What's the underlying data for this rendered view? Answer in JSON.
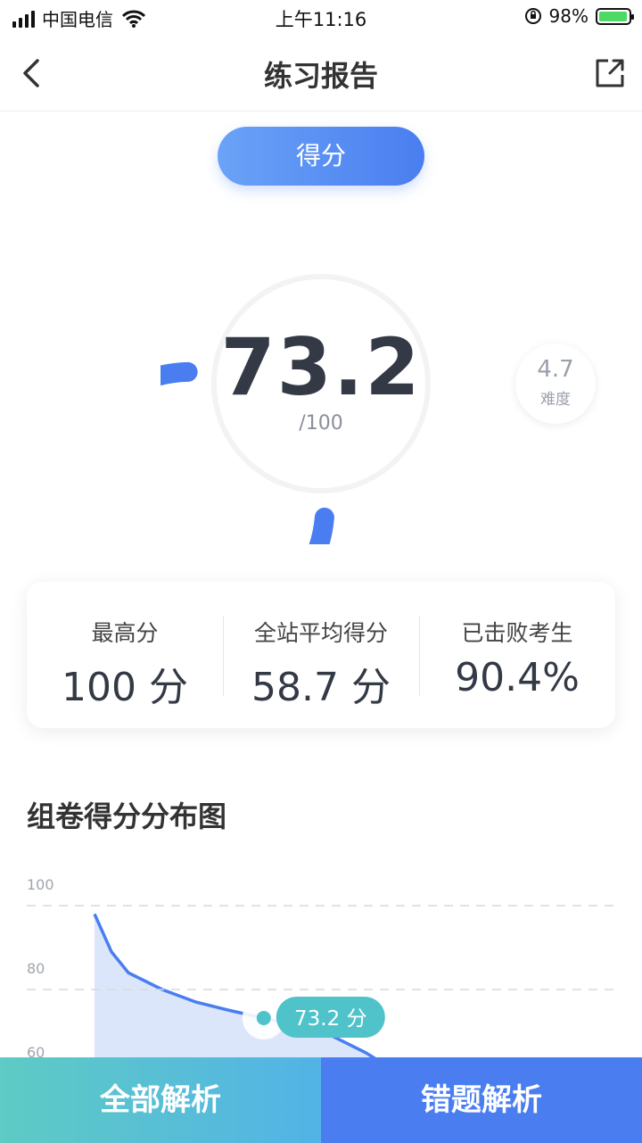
{
  "status_bar": {
    "carrier": "中国电信",
    "time": "上午11:16",
    "battery_percent": "98%",
    "battery_level": 0.98,
    "icons": [
      "signal-icon",
      "wifi-icon",
      "orientation-lock-icon",
      "battery-charging-icon"
    ]
  },
  "nav": {
    "title": "练习报告",
    "back_icon": "chevron-left-icon",
    "share_icon": "share-external-icon"
  },
  "score_tab": {
    "label": "得分"
  },
  "score": {
    "value": "73.2",
    "total": "/100",
    "numeric": 73.2,
    "max": 100,
    "accent_color": "#4a7ef0"
  },
  "difficulty": {
    "value": "4.7",
    "label": "难度"
  },
  "stats": [
    {
      "label": "最高分",
      "value": "100 分"
    },
    {
      "label": "全站平均得分",
      "value": "58.7 分"
    },
    {
      "label": "已击败考生",
      "value": "90.4%"
    }
  ],
  "distribution": {
    "title": "组卷得分分布图",
    "marker_label": "73.2 分",
    "accent_color": "#4a7ef0",
    "fill_color": "#dce6fb",
    "marker_color": "#4fc3c9"
  },
  "chart_data": {
    "type": "area",
    "title": "组卷得分分布图",
    "yticks": [
      100,
      80,
      60
    ],
    "ylim": [
      55,
      105
    ],
    "x": [
      0,
      0.05,
      0.1,
      0.2,
      0.3,
      0.4,
      0.5,
      0.6,
      0.7,
      0.8,
      0.9,
      1.0
    ],
    "y": [
      98,
      89,
      84,
      80,
      77,
      75,
      73.2,
      71.5,
      69,
      65,
      60,
      55
    ],
    "marker": {
      "x": 0.5,
      "y": 73.2,
      "label": "73.2 分"
    },
    "grid": true
  },
  "bottom_buttons": {
    "all_analysis": "全部解析",
    "wrong_analysis": "错题解析"
  }
}
